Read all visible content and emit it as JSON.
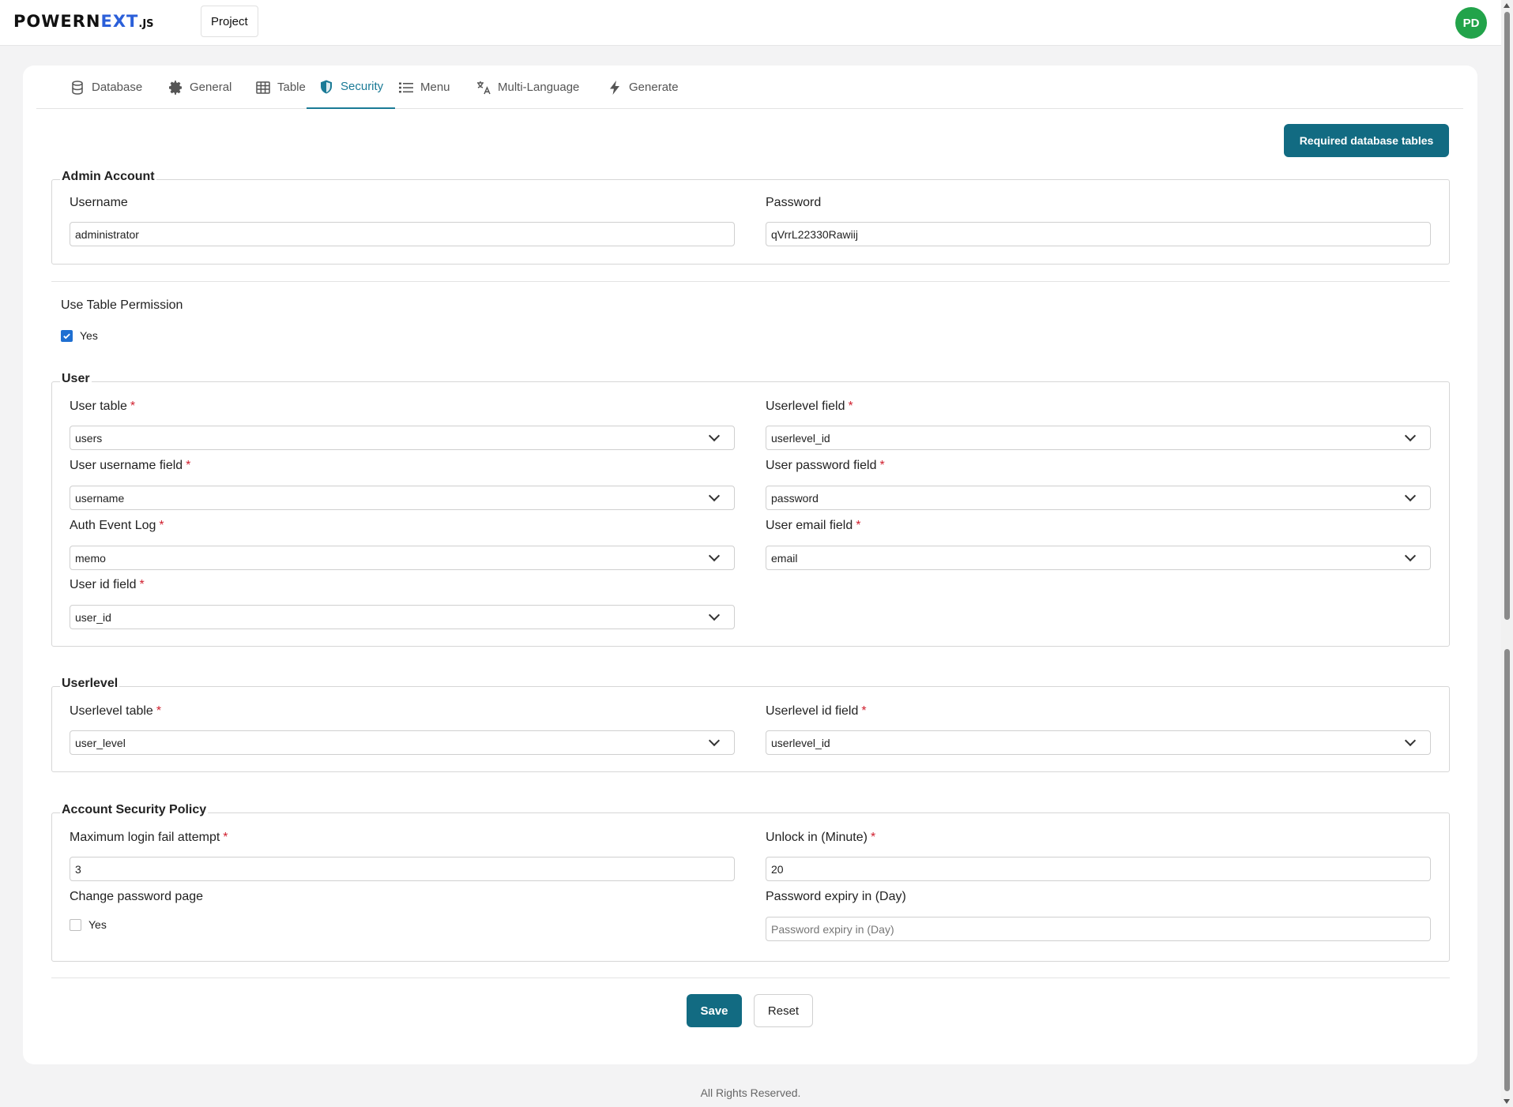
{
  "header": {
    "logo_main": "POWERN",
    "logo_accent": "EXT",
    "logo_suffix": ".JS",
    "project_label": "Project",
    "avatar_initials": "PD"
  },
  "tabs": [
    {
      "label": "Database",
      "icon": "database-icon"
    },
    {
      "label": "General",
      "icon": "gear-icon"
    },
    {
      "label": "Table",
      "icon": "table-icon"
    },
    {
      "label": "Security",
      "icon": "shield-icon",
      "active": true
    },
    {
      "label": "Menu",
      "icon": "list-icon"
    },
    {
      "label": "Multi-Language",
      "icon": "translate-icon"
    },
    {
      "label": "Generate",
      "icon": "bolt-icon"
    }
  ],
  "required_tables_label": "Required database tables",
  "admin": {
    "legend": "Admin Account",
    "username_label": "Username",
    "username_value": "administrator",
    "password_label": "Password",
    "password_value": "qVrrL22330Rawiij"
  },
  "table_permission": {
    "label": "Use Table Permission",
    "option": "Yes",
    "checked": true
  },
  "user": {
    "legend": "User",
    "user_table_label": "User table",
    "user_table_value": "users",
    "userlevel_field_label": "Userlevel field",
    "userlevel_field_value": "userlevel_id",
    "username_field_label": "User username field",
    "username_field_value": "username",
    "password_field_label": "User password field",
    "password_field_value": "password",
    "auth_log_label": "Auth Event Log",
    "auth_log_value": "memo",
    "email_field_label": "User email field",
    "email_field_value": "email",
    "id_field_label": "User id field",
    "id_field_value": "user_id"
  },
  "userlevel": {
    "legend": "Userlevel",
    "table_label": "Userlevel table",
    "table_value": "user_level",
    "id_field_label": "Userlevel id field",
    "id_field_value": "userlevel_id"
  },
  "policy": {
    "legend": "Account Security Policy",
    "max_fail_label": "Maximum login fail attempt",
    "max_fail_value": "3",
    "unlock_label": "Unlock in (Minute)",
    "unlock_value": "20",
    "change_pw_label": "Change password page",
    "change_pw_option": "Yes",
    "change_pw_checked": false,
    "expiry_label": "Password expiry in (Day)",
    "expiry_placeholder": "Password expiry in (Day)"
  },
  "actions": {
    "save_label": "Save",
    "reset_label": "Reset"
  },
  "footer": "All Rights Reserved.",
  "colors": {
    "primary": "#126b82",
    "active_tab": "#1a7a96",
    "avatar": "#22a34a",
    "required_mark": "#d0202f",
    "checkbox": "#1f6fd1"
  }
}
